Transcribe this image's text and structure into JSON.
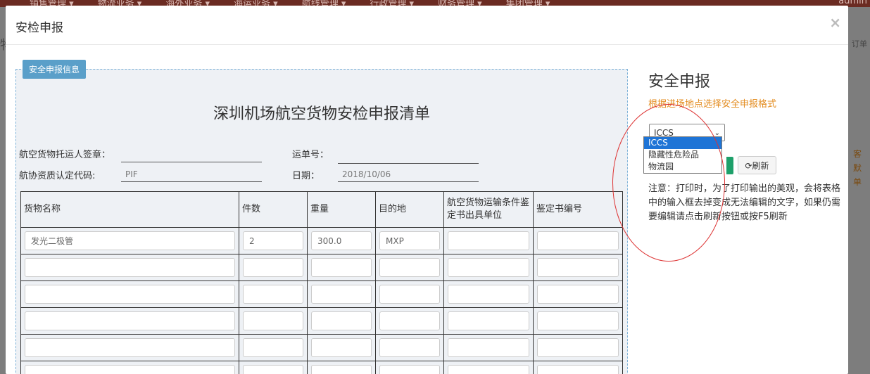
{
  "bg": {
    "menu": [
      "销售管理 ▾",
      "物流业务 ▾",
      "海外业务 ▾",
      "海运业务 ▾",
      "航线管理 ▾",
      "行政管理 ▾",
      "财务管理 ▾",
      "集团管理 ▾"
    ],
    "user": "admin",
    "left_char": "物",
    "right_text": "订单",
    "right_orange": [
      "客",
      "默",
      "单"
    ]
  },
  "modal": {
    "title": "安检申报",
    "close": "×"
  },
  "panel": {
    "tag": "安全申报信息",
    "doc_title": "深圳机场航空货物安检申报清单",
    "fields": {
      "shipper_sign_label": "航空货物托运人签章：",
      "shipper_sign_value": "",
      "awb_label": "运单号：",
      "awb_value": "",
      "iata_code_label": "航协资质认定代码:",
      "iata_code_value": "PIF",
      "date_label": "日期：",
      "date_value": "2018/10/06"
    },
    "table": {
      "headers": [
        "货物名称",
        "件数",
        "重量",
        "目的地",
        "航空货物运输条件鉴定书出具单位",
        "鉴定书编号"
      ],
      "rows": [
        [
          "发光二极管",
          "2",
          "300.0",
          "MXP",
          "",
          ""
        ],
        [
          "",
          "",
          "",
          "",
          "",
          ""
        ],
        [
          "",
          "",
          "",
          "",
          "",
          ""
        ],
        [
          "",
          "",
          "",
          "",
          "",
          ""
        ],
        [
          "",
          "",
          "",
          "",
          "",
          ""
        ],
        [
          "",
          "",
          "",
          "",
          "",
          ""
        ]
      ]
    }
  },
  "right": {
    "title": "安全申报",
    "hint": "根据进场地点选择安全申报格式",
    "select_value": "ICCS",
    "options": [
      "ICCS",
      "隐藏性危险品",
      "物流园"
    ],
    "refresh_label": "刷新",
    "note": "注意：打印时，为了打印输出的美观，会将表格中的输入框去掉变成无法编辑的文字，如果仍需要编辑请点击刷新按钮或按F5刷新"
  },
  "colors": {
    "accent": "#5a9fc9",
    "hint": "#e38b1d",
    "selected": "#1e74d6",
    "annotation": "#dd3333"
  }
}
